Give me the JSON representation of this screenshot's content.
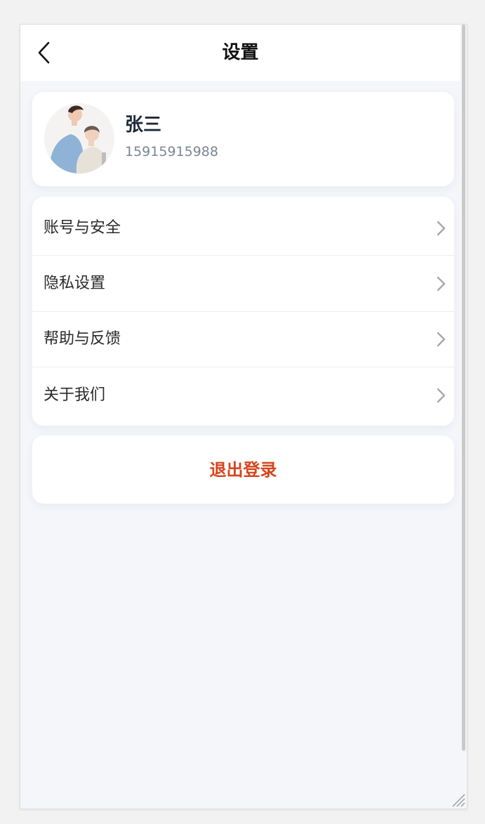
{
  "header": {
    "title": "设置"
  },
  "profile": {
    "name": "张三",
    "phone": "15915915988"
  },
  "menu": {
    "items": [
      {
        "label": "账号与安全"
      },
      {
        "label": "隐私设置"
      },
      {
        "label": "帮助与反馈"
      },
      {
        "label": "关于我们"
      }
    ]
  },
  "logout": {
    "label": "退出登录"
  },
  "colors": {
    "accent": "#d4451c",
    "background": "#f5f6fa",
    "card": "#ffffff"
  }
}
